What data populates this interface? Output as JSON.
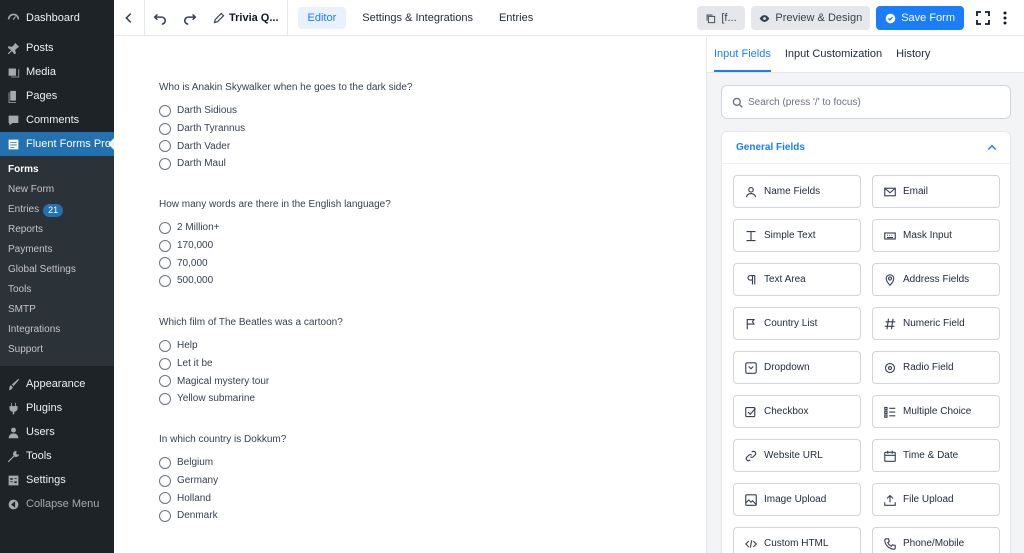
{
  "wp_menu": {
    "dashboard": "Dashboard",
    "posts": "Posts",
    "media": "Media",
    "pages": "Pages",
    "comments": "Comments",
    "fluent": "Fluent Forms Pro",
    "sub": {
      "forms": "Forms",
      "new_form": "New Form",
      "entries": "Entries",
      "entries_count": "21",
      "reports": "Reports",
      "payments": "Payments",
      "global_settings": "Global Settings",
      "tools": "Tools",
      "smtp": "SMTP",
      "integrations": "Integrations",
      "support": "Support"
    },
    "appearance": "Appearance",
    "plugins": "Plugins",
    "users": "Users",
    "tools": "Tools",
    "settings": "Settings",
    "collapse": "Collapse Menu"
  },
  "toolbar": {
    "form_title": "Trivia Q...",
    "tabs": [
      "Editor",
      "Settings & Integrations",
      "Entries"
    ],
    "shortcode_label": "[f...",
    "preview_label": "Preview & Design",
    "save_label": "Save Form"
  },
  "form": {
    "questions": [
      {
        "label": "Who is Anakin Skywalker when he goes to the dark side?",
        "options": [
          "Darth Sidious",
          "Darth Tyrannus",
          "Darth Vader",
          "Darth Maul"
        ]
      },
      {
        "label": "How many words are there in the English language?",
        "options": [
          "2 Million+",
          "170,000",
          "70,000",
          "500,000"
        ]
      },
      {
        "label": "Which film of The Beatles was a cartoon?",
        "options": [
          "Help",
          "Let it be",
          "Magical mystery tour",
          "Yellow submarine"
        ]
      },
      {
        "label": "In which country is Dokkum?",
        "options": [
          "Belgium",
          "Germany",
          "Holland",
          "Denmark"
        ]
      }
    ]
  },
  "panel": {
    "tabs": [
      "Input Fields",
      "Input Customization",
      "History"
    ],
    "search_placeholder": "Search (press '/' to focus)",
    "section_title": "General Fields",
    "fields": [
      {
        "label": "Name Fields",
        "icon": "user-icon"
      },
      {
        "label": "Email",
        "icon": "email-icon"
      },
      {
        "label": "Simple Text",
        "icon": "text-cursor-icon"
      },
      {
        "label": "Mask Input",
        "icon": "keyboard-icon"
      },
      {
        "label": "Text Area",
        "icon": "paragraph-icon"
      },
      {
        "label": "Address Fields",
        "icon": "map-pin-icon"
      },
      {
        "label": "Country List",
        "icon": "flag-icon"
      },
      {
        "label": "Numeric Field",
        "icon": "hash-icon"
      },
      {
        "label": "Dropdown",
        "icon": "dropdown-icon"
      },
      {
        "label": "Radio Field",
        "icon": "radio-icon"
      },
      {
        "label": "Checkbox",
        "icon": "checkbox-icon"
      },
      {
        "label": "Multiple Choice",
        "icon": "list-icon"
      },
      {
        "label": "Website URL",
        "icon": "link-icon"
      },
      {
        "label": "Time & Date",
        "icon": "calendar-icon"
      },
      {
        "label": "Image Upload",
        "icon": "image-icon"
      },
      {
        "label": "File Upload",
        "icon": "upload-icon"
      },
      {
        "label": "Custom HTML",
        "icon": "code-icon"
      },
      {
        "label": "Phone/Mobile",
        "icon": "phone-icon"
      }
    ]
  },
  "colors": {
    "accent": "#1a7efb",
    "wp_sidebar": "#1d2327",
    "wp_active": "#2271b1"
  }
}
